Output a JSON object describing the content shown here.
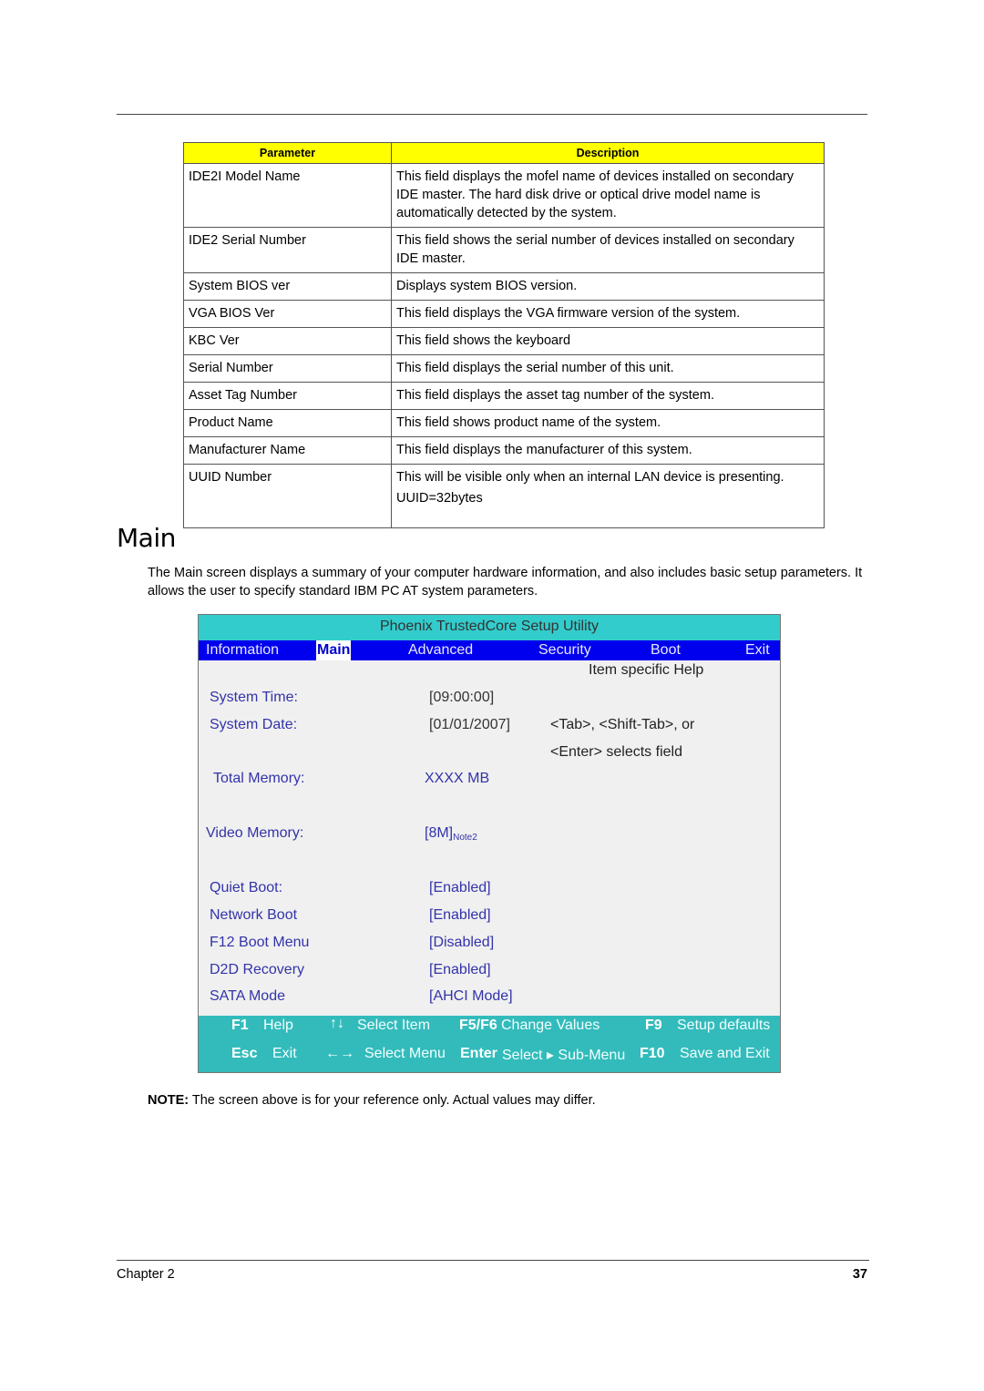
{
  "table": {
    "headers": [
      "Parameter",
      "Description"
    ],
    "rows": [
      {
        "parameter": "IDE2I Model Name",
        "description": [
          "This field displays the mofel name of devices installed on secondary IDE master. The hard disk drive or optical drive model name is automatically detected by the system."
        ]
      },
      {
        "parameter": "IDE2 Serial Number",
        "description": [
          "This field shows the serial number of devices installed on secondary IDE master."
        ]
      },
      {
        "parameter": "System BIOS ver",
        "description": [
          "Displays system BIOS version."
        ]
      },
      {
        "parameter": "VGA BIOS Ver",
        "description": [
          "This field displays the VGA firmware version of the system."
        ]
      },
      {
        "parameter": "KBC Ver",
        "description": [
          "This field shows the keyboard"
        ]
      },
      {
        "parameter": "Serial Number",
        "description": [
          "This field displays the serial number of this unit."
        ]
      },
      {
        "parameter": "Asset Tag Number",
        "description": [
          "This field displays the asset tag number of the system."
        ]
      },
      {
        "parameter": "Product Name",
        "description": [
          "This field shows product name of the system."
        ]
      },
      {
        "parameter": "Manufacturer Name",
        "description": [
          "This field displays the manufacturer of this system."
        ]
      },
      {
        "parameter": "UUID Number",
        "description": [
          "This will be visible only when an internal LAN device is presenting.",
          "UUID=32bytes"
        ]
      }
    ]
  },
  "section": {
    "title": "Main",
    "intro": "The Main screen displays a summary of your computer hardware information, and also includes basic setup parameters. It allows the user to specify standard IBM PC AT system parameters."
  },
  "bios": {
    "title": "Phoenix TrustedCore Setup Utility",
    "menu": [
      "Information",
      "Main",
      "Advanced",
      "Security",
      "Boot",
      "Exit"
    ],
    "active_menu": "Main",
    "help_title": "Item specific Help",
    "help_lines": [
      "<Tab>, <Shift-Tab>, or",
      "<Enter> selects field"
    ],
    "items": [
      {
        "label": "System Time:",
        "value": "[09:00:00]"
      },
      {
        "label": "System Date:",
        "value": "[01/01/2007]"
      },
      {
        "label": "Total Memory:",
        "value": "XXXX MB"
      },
      {
        "label": "Video Memory:",
        "value": "[8M]",
        "note": "Note2"
      },
      {
        "label": "Quiet Boot:",
        "value": "[Enabled]"
      },
      {
        "label": "Network Boot",
        "value": "[Enabled]"
      },
      {
        "label": "F12 Boot Menu",
        "value": "[Disabled]"
      },
      {
        "label": "D2D Recovery",
        "value": "[Enabled]"
      },
      {
        "label": "SATA Mode",
        "value": "[AHCI Mode]"
      }
    ],
    "footer": {
      "row1": [
        {
          "key": "F1",
          "action": "Help"
        },
        {
          "key": "↑↓",
          "action": "Select Item"
        },
        {
          "key": "F5/F6",
          "action": "Change Values"
        },
        {
          "key": "F9",
          "action": "Setup defaults"
        }
      ],
      "row2": [
        {
          "key": "Esc",
          "action": "Exit"
        },
        {
          "key": "←→",
          "action": "Select Menu"
        },
        {
          "key": "Enter",
          "action": "Select ▸ Sub-Menu"
        },
        {
          "key": "F10",
          "action": "Save and Exit"
        }
      ]
    }
  },
  "note": {
    "label": "NOTE:",
    "text": " The screen above is for your reference only. Actual values may differ."
  },
  "page_footer": {
    "chapter": "Chapter 2",
    "page_number": "37"
  }
}
